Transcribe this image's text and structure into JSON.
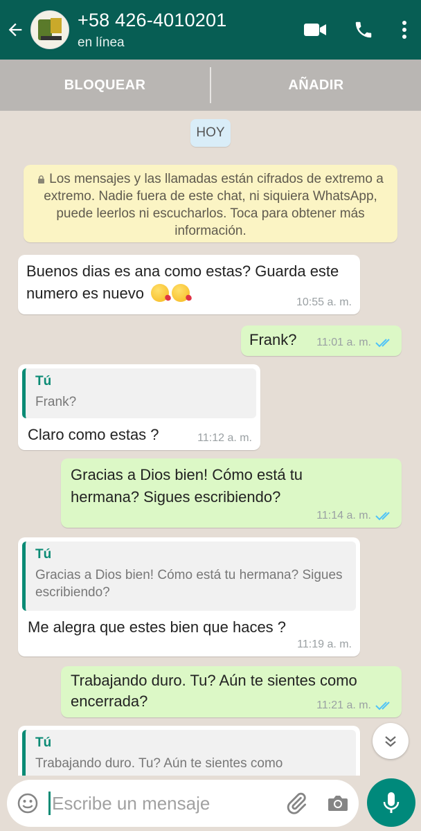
{
  "header": {
    "contact_name": "+58 426-4010201",
    "status": "en línea",
    "bg_color": "#075e54"
  },
  "actions": {
    "block_label": "BLOQUEAR",
    "add_label": "AÑADIR"
  },
  "chat": {
    "date_chip": "HOY",
    "system_notice": "Los mensajes y las llamadas están cifrados de extremo a extremo. Nadie fuera de este chat, ni siquiera WhatsApp, puede leerlos ni escucharlos. Toca para obtener más información.",
    "messages": [
      {
        "direction": "in",
        "text": "Buenos dias es ana como estas? Guarda este numero es nuevo",
        "emoji": "kissing-face-with-heart x2",
        "time": "10:55 a. m."
      },
      {
        "direction": "out",
        "text": "Frank?",
        "time": "11:01 a. m.",
        "status": "read"
      },
      {
        "direction": "in",
        "quote_author": "Tú",
        "quote_text": "Frank?",
        "text": "Claro como estas ?",
        "time": "11:12 a. m."
      },
      {
        "direction": "out",
        "text": "Gracias a Dios bien! Cómo está tu hermana? Sigues escribiendo?",
        "time": "11:14 a. m.",
        "status": "read"
      },
      {
        "direction": "in",
        "quote_author": "Tú",
        "quote_text": "Gracias a Dios bien! Cómo está tu hermana? Sigues escribiendo?",
        "text": "Me alegra que estes bien que haces ?",
        "time": "11:19 a. m."
      },
      {
        "direction": "out",
        "text": "Trabajando duro. Tu? Aún te sientes como encerrada?",
        "time": "11:21 a. m.",
        "status": "read"
      },
      {
        "direction": "in",
        "quote_author": "Tú",
        "quote_text": "Trabajando duro. Tu? Aún te sientes como",
        "partial": true
      }
    ]
  },
  "composer": {
    "placeholder": "Escribe un mensaje"
  },
  "colors": {
    "incoming_bubble": "#ffffff",
    "outgoing_bubble": "#dcf8c6",
    "accent": "#0b8b75",
    "read_ticks": "#4fc3f7"
  }
}
